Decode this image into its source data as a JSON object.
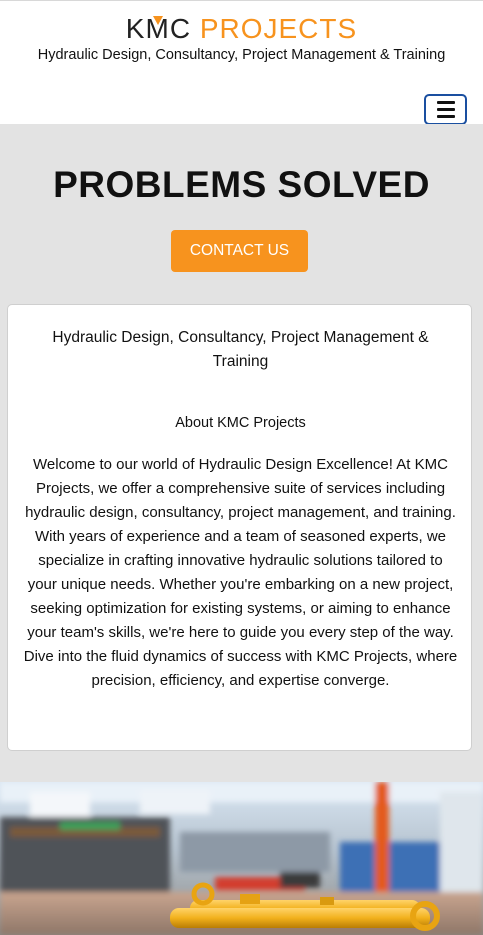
{
  "header": {
    "logo_left": "K",
    "logo_m": "M",
    "logo_c": "C",
    "logo_right": "PROJECTS",
    "tagline": "Hydraulic Design, Consultancy, Project Management & Training",
    "menu_icon": "hamburger-icon"
  },
  "hero": {
    "title": "PROBLEMS SOLVED",
    "cta_label": "CONTACT US"
  },
  "about": {
    "heading": "Hydraulic Design, Consultancy, Project Management & Training",
    "subheading": "About KMC Projects",
    "body": "Welcome to our world of Hydraulic Design Excellence! At KMC Projects, we offer a comprehensive suite of services including hydraulic design, consultancy, project management, and training. With years of experience and a team of seasoned experts, we specialize in crafting innovative hydraulic solutions tailored to your unique needs. Whether you're embarking on a new project, seeking optimization for existing systems, or aiming to enhance your team's skills, we're here to guide you every step of the way. Dive into the fluid dynamics of success with KMC Projects, where precision, efficiency, and expertise converge."
  },
  "colors": {
    "accent": "#f7931e",
    "hero_bg": "#e3e3e3",
    "menu_border": "#1a4fa0"
  }
}
